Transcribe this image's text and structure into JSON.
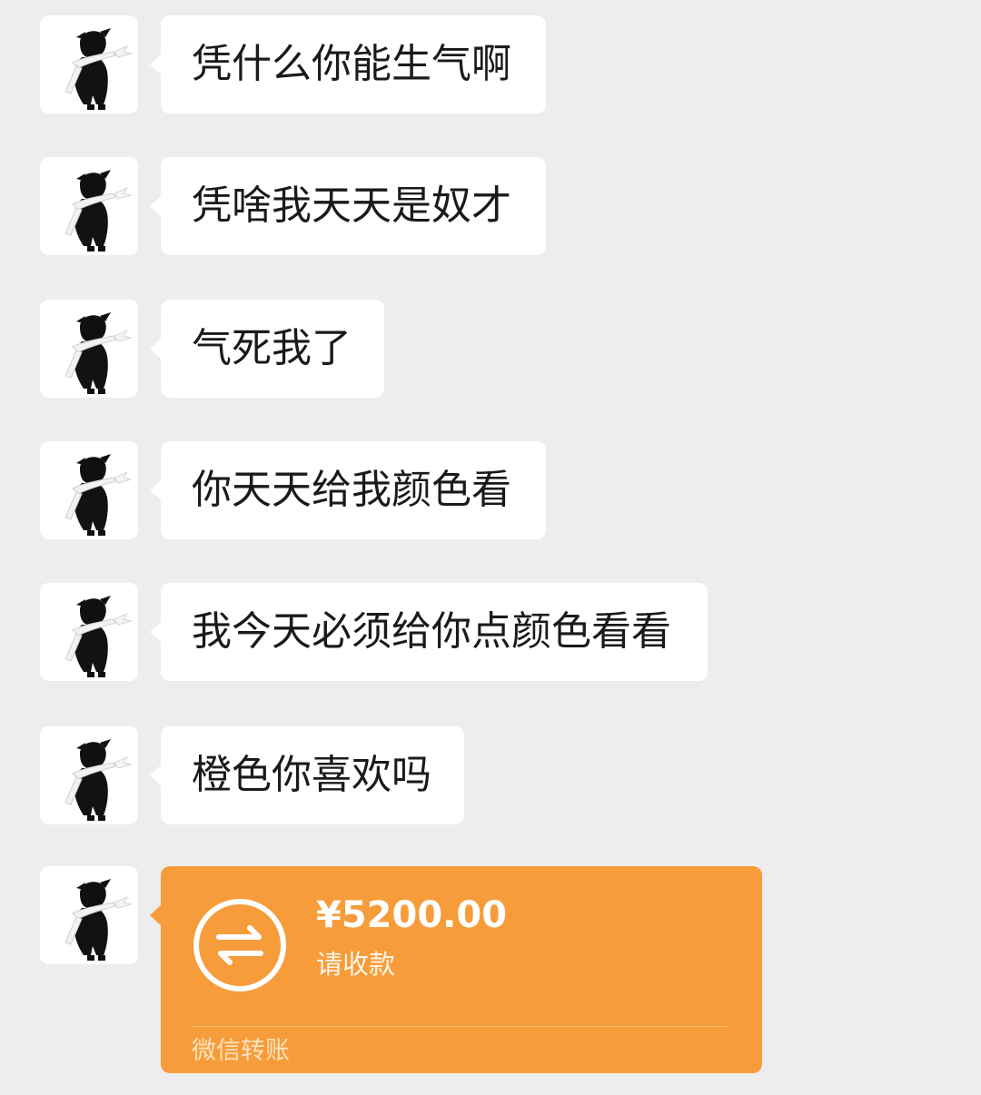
{
  "chat": {
    "messages": [
      {
        "type": "text",
        "text": "凭什么你能生气啊"
      },
      {
        "type": "text",
        "text": "凭啥我天天是奴才"
      },
      {
        "type": "text",
        "text": "气死我了"
      },
      {
        "type": "text",
        "text": "你天天给我颜色看"
      },
      {
        "type": "text",
        "text": "我今天必须给你点颜色看看"
      },
      {
        "type": "text",
        "text": "橙色你喜欢吗"
      },
      {
        "type": "transfer",
        "amount": "¥5200.00",
        "note": "请收款",
        "footer": "微信转账"
      }
    ]
  },
  "avatar": {
    "icon": "anime-boy-avatar-icon"
  },
  "transfer_icon": "exchange-arrows-icon",
  "colors": {
    "background": "#ededed",
    "bubble": "#ffffff",
    "transfer": "#f79c3a"
  }
}
